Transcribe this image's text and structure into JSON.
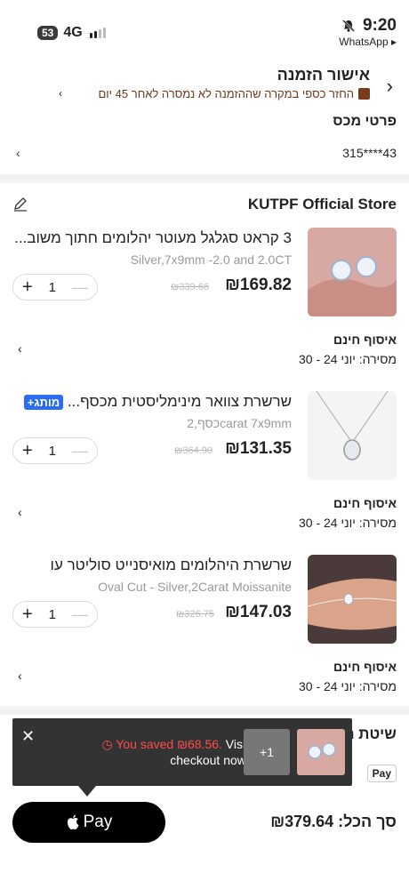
{
  "status_bar": {
    "battery": "53",
    "network": "4G",
    "time": "9:20",
    "back_app": "WhatsApp ▸"
  },
  "header": {
    "title": "אישור הזמנה",
    "notice": "החזר כספי במקרה שההזמנה לא נמסרה לאחר 45 יום"
  },
  "customs": {
    "label": "פרטי מכס",
    "value": "315****43"
  },
  "store": {
    "name": "KUTPF Official Store"
  },
  "products": [
    {
      "title": "3 קראט סגלגל מעוטר יהלומים חתוך משוב...",
      "badge": "",
      "variant": "Silver,7x9mm -2.0 and 2.0CT",
      "price": "₪169.82",
      "old_price": "₪339.66",
      "qty": "1",
      "ship_title": "איסוף חינם",
      "ship_date": "מסירה: יוני 24 - 30"
    },
    {
      "title": "שרשרת צוואר מינימליסטית מכסף...",
      "badge": "מותג+",
      "variant": "כסף,2carat 7x9mm",
      "price": "₪131.35",
      "old_price": "₪364.90",
      "qty": "1",
      "ship_title": "איסוף חינם",
      "ship_date": "מסירה: יוני 24 - 30"
    },
    {
      "title": "שרשרת היהלומים מואיסנייט סוליטר עו",
      "badge": "",
      "variant": "Oval Cut - Silver,2Carat Moissanite",
      "price": "₪147.03",
      "old_price": "₪326.75",
      "qty": "1",
      "ship_title": "איסוף חינם",
      "ship_date": "מסירה: יוני 24 - 30"
    }
  ],
  "payment": {
    "label": "שיטת ת",
    "method": "Pay"
  },
  "toast": {
    "saved": "You saved ₪68.56.",
    "rest": " Visit checkout now.",
    "extra": "+1"
  },
  "footer": {
    "pay_button": "Pay",
    "total": "סך הכל: ₪379.64"
  },
  "colors": {
    "accent": "#2a6df4",
    "saved_red": "#ff4c4c",
    "notice_brown": "#6b3a1f"
  }
}
